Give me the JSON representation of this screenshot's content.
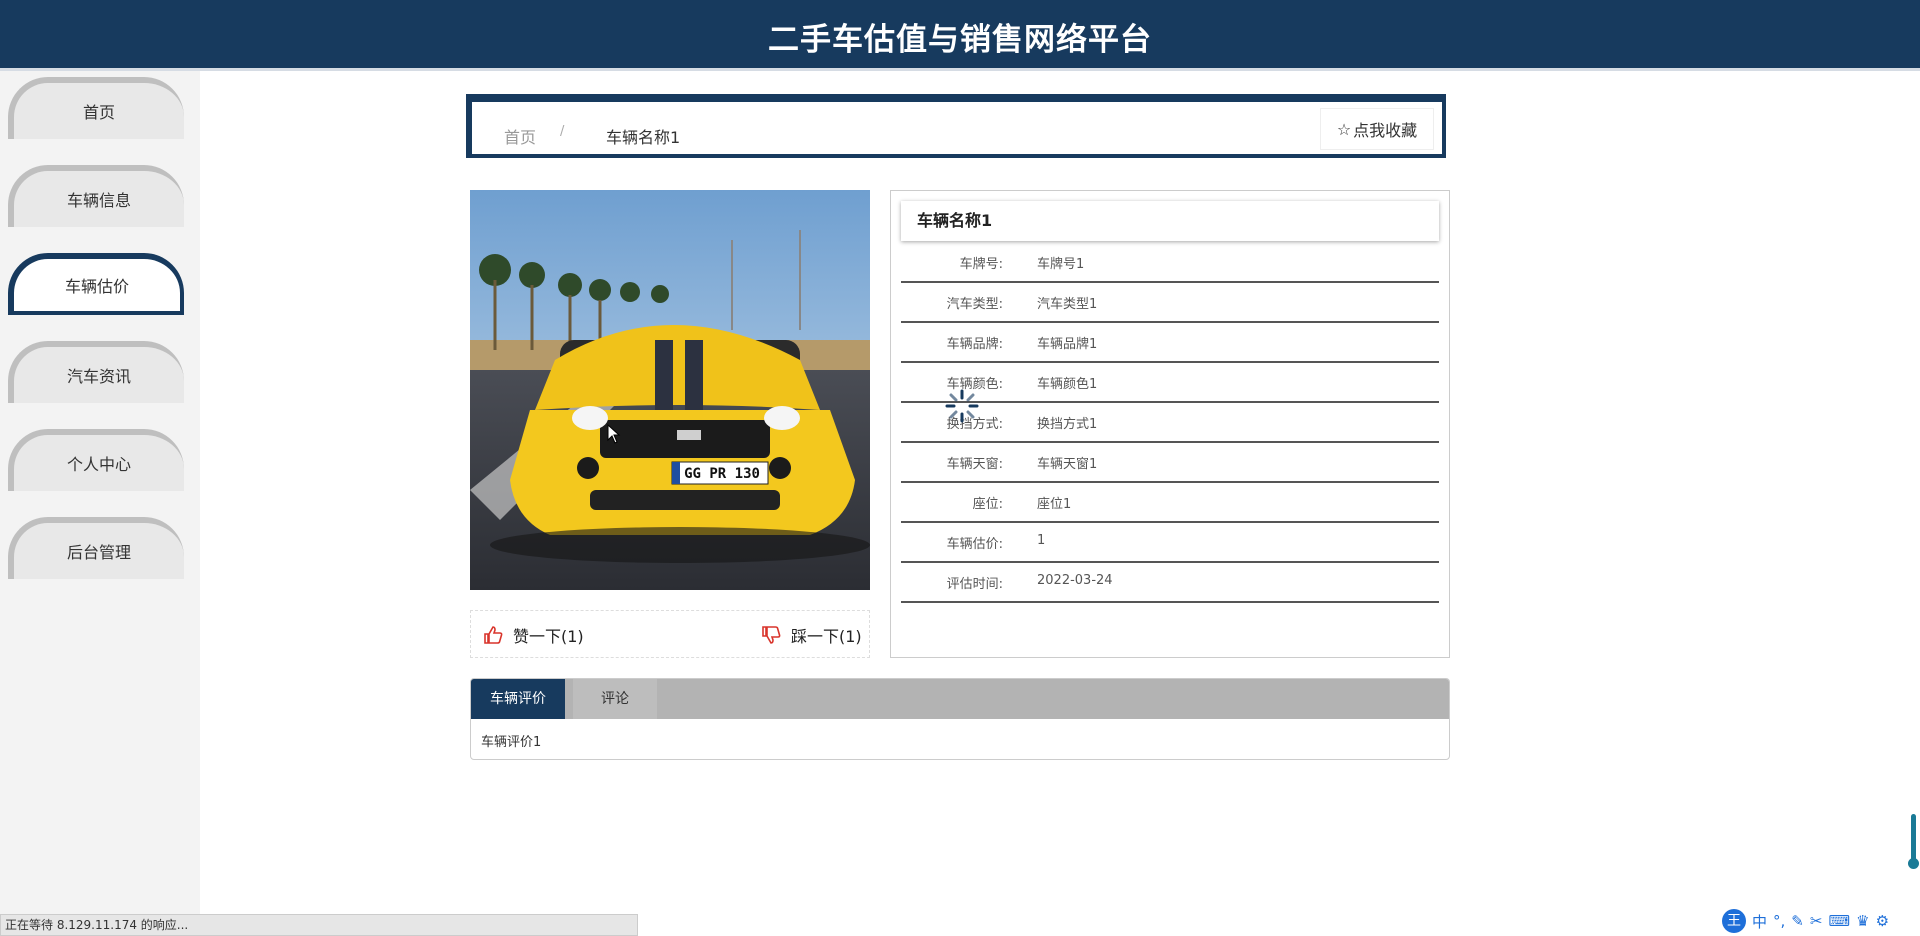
{
  "app": {
    "title": "二手车估值与销售网络平台"
  },
  "sidebar": {
    "items": [
      {
        "label": "首页"
      },
      {
        "label": "车辆信息"
      },
      {
        "label": "车辆估价"
      },
      {
        "label": "汽车资讯"
      },
      {
        "label": "个人中心"
      },
      {
        "label": "后台管理"
      }
    ],
    "active_index": 2
  },
  "breadcrumb": {
    "home": "首页",
    "separator": "/",
    "current": "车辆名称1"
  },
  "favorite": {
    "label": "点我收藏"
  },
  "votes": {
    "like_label": "赞一下(1)",
    "dislike_label": "踩一下(1)"
  },
  "detail": {
    "title": "车辆名称1",
    "rows": [
      {
        "label": "车牌号:",
        "value": "车牌号1"
      },
      {
        "label": "汽车类型:",
        "value": "汽车类型1"
      },
      {
        "label": "车辆品牌:",
        "value": "车辆品牌1"
      },
      {
        "label": "车辆颜色:",
        "value": "车辆颜色1"
      },
      {
        "label": "换挡方式:",
        "value": "换挡方式1"
      },
      {
        "label": "车辆天窗:",
        "value": "车辆天窗1"
      },
      {
        "label": "座位:",
        "value": "座位1"
      },
      {
        "label": "车辆估价:",
        "value": "1"
      },
      {
        "label": "评估时间:",
        "value": "2022-03-24"
      }
    ]
  },
  "tabs": {
    "items": [
      {
        "label": "车辆评价"
      },
      {
        "label": "评论"
      }
    ],
    "active_content": "车辆评价1"
  },
  "car_image": {
    "plate_text": "GG PR 130"
  },
  "status_bar": {
    "text": "正在等待 8.129.11.174 的响应..."
  },
  "ime": {
    "logo": "王",
    "mode": "中"
  },
  "colors": {
    "primary": "#173a5e",
    "like": "#d9342b"
  }
}
